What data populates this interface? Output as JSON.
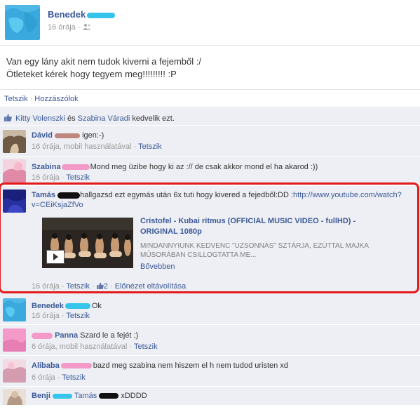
{
  "post": {
    "author": "Benedek",
    "time": "16 órája",
    "body_line1": "Van egy lány akit nem tudok kiverni a fejemből :/",
    "body_line2": "Ötleteket kérek hogy tegyem meg!!!!!!!!! :P",
    "like_action": "Tetszik",
    "comment_action": "Hozzászólok",
    "separator": "·"
  },
  "likes": {
    "person1": "Kitty Volenszki",
    "conjunction": "és",
    "person2": "Szabina Váradi",
    "suffix": "kedvelik ezt."
  },
  "comments": [
    {
      "name": "Dávid",
      "text": "igen:-)",
      "time": "16 órája, mobil használatával",
      "like": "Tetszik"
    },
    {
      "name": "Szabina",
      "text": "Mond meg üzibe hogy ki az :// de csak akkor mond el ha akarod :))",
      "time": "16 órája",
      "like": "Tetszik"
    },
    {
      "name": "Tamás",
      "text": "hallgazsd ezt egymás után 6x tuti hogy kivered a fejedből:DD :",
      "link": "http://www.youtube.com/watch?v=CEiKsjaZfVo",
      "time": "16 órája",
      "like": "Tetszik",
      "like_count": "2",
      "preview_remove": "Előnézet eltávolítása"
    },
    {
      "name": "Benedek",
      "text": "Ok",
      "time": "16 órája",
      "like": "Tetszik"
    },
    {
      "name": "Panna",
      "text": "Szard le a fejét ;)",
      "time": "6 órája, mobil használatával",
      "like": "Tetszik"
    },
    {
      "name": "Alibaba",
      "text": "bazd meg szabina nem hiszem el h nem tudod uristen xd",
      "time": "6 órája",
      "like": "Tetszik"
    },
    {
      "name": "Benji",
      "name2": "Tamás",
      "text": "xDDDD"
    }
  ],
  "share": {
    "title": "Cristofel - Kubai ritmus (OFFICIAL MUSIC VIDEO - fullHD) - ORIGINAL 1080p",
    "description": "MINDANNYIUNK KEDVENC \"UZSONNÁS\" SZTÁRJA, EZÚTTAL MAJKA MŰSORÁBAN CSILLOGTATTA ME...",
    "more": "Bővebben"
  },
  "colors": {
    "link": "#3b5998",
    "feedback_bg": "#edeff4",
    "highlight": "#e51a1a",
    "redaction_cyan": "#35c4ec",
    "redaction_pink": "#f49ac8"
  }
}
